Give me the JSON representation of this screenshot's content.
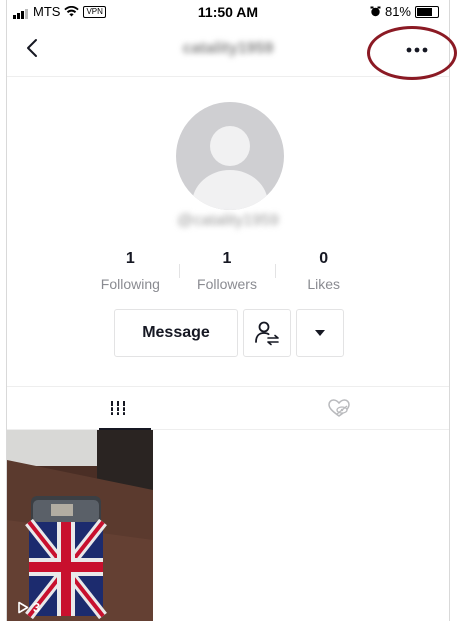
{
  "status_bar": {
    "carrier": "MTS",
    "vpn": "VPN",
    "time": "11:50 AM",
    "battery": "81%",
    "battery_level": 0.81
  },
  "header": {
    "username": "catality1959",
    "back_icon": "chevron-left-icon",
    "more_icon": "more-horizontal-icon"
  },
  "profile": {
    "handle": "@catality1959",
    "stats": [
      {
        "value": "1",
        "label": "Following"
      },
      {
        "value": "1",
        "label": "Followers"
      },
      {
        "value": "0",
        "label": "Likes"
      }
    ],
    "message_label": "Message"
  },
  "tabs": [
    {
      "icon": "grid-icon",
      "active": true
    },
    {
      "icon": "liked-hidden-icon",
      "active": false
    }
  ],
  "videos": [
    {
      "plays": "3"
    }
  ],
  "colors": {
    "annotation_ring": "#8b1a24",
    "avatar_bg": "#cfcfd2",
    "secondary_text": "#8a8b91"
  }
}
